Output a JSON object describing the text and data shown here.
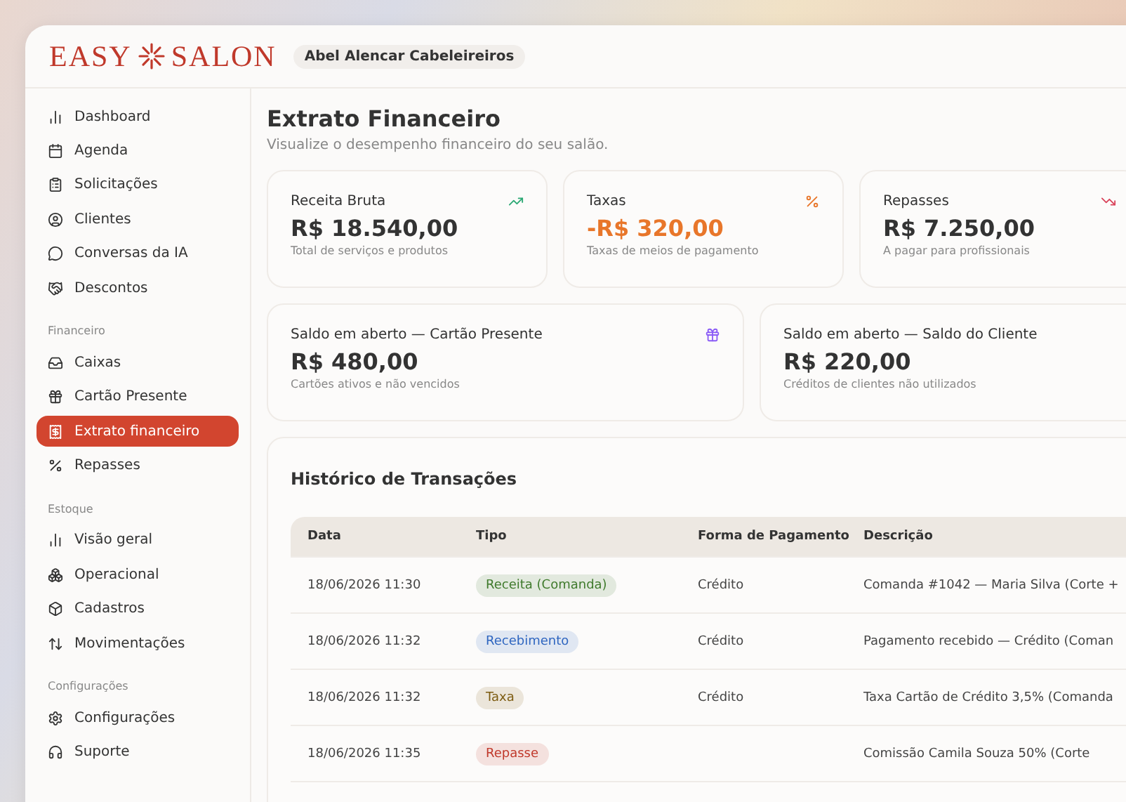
{
  "header": {
    "logo_left": "EASY",
    "logo_right": "SALON",
    "business": "Abel Alencar Cabeleireiros"
  },
  "sidebar": [
    {
      "items": [
        {
          "label": "Dashboard",
          "selected": false
        },
        {
          "label": "Agenda",
          "selected": false
        },
        {
          "label": "Solicitações",
          "selected": false
        },
        {
          "label": "Clientes",
          "selected": false
        },
        {
          "label": "Conversas da IA",
          "selected": false
        },
        {
          "label": "Descontos",
          "selected": false
        }
      ]
    },
    {
      "title": "Financeiro",
      "items": [
        {
          "label": "Caixas",
          "selected": false
        },
        {
          "label": "Cartão Presente",
          "selected": false
        },
        {
          "label": "Extrato financeiro",
          "selected": true
        },
        {
          "label": "Repasses",
          "selected": false
        }
      ]
    },
    {
      "title": "Estoque",
      "items": [
        {
          "label": "Visão geral",
          "selected": false
        },
        {
          "label": "Operacional",
          "selected": false
        },
        {
          "label": "Cadastros",
          "selected": false
        },
        {
          "label": "Movimentações",
          "selected": false
        }
      ]
    },
    {
      "title": "Configurações",
      "items": [
        {
          "label": "Configurações",
          "selected": false
        },
        {
          "label": "Suporte",
          "selected": false
        }
      ]
    }
  ],
  "page": {
    "title": "Extrato Financeiro",
    "subtitle": "Visualize o desempenho financeiro do seu salão."
  },
  "stats": [
    {
      "label": "Receita Bruta",
      "value": "R$ 18.540,00",
      "note": "Total de serviços e produtos",
      "negative": false
    },
    {
      "label": "Taxas",
      "value": "-R$ 320,00",
      "note": "Taxas de meios de pagamento",
      "negative": true
    },
    {
      "label": "Repasses",
      "value": "R$ 7.250,00",
      "note": "A pagar para profissionais",
      "negative": false
    }
  ],
  "balances": [
    {
      "label": "Saldo em aberto — Cartão Presente",
      "value": "R$ 480,00",
      "note": "Cartões ativos e não vencidos"
    },
    {
      "label": "Saldo em aberto — Saldo do Cliente",
      "value": "R$ 220,00",
      "note": "Créditos de clientes não utilizados"
    }
  ],
  "history": {
    "title": "Histórico de Transações",
    "columns": [
      "Data",
      "Tipo",
      "Forma de Pagamento",
      "Descrição"
    ],
    "rows": [
      {
        "date": "18/06/2026 11:30",
        "type": "Receita (Comanda)",
        "color": "#3f7a2c",
        "payment": "Crédito",
        "description": "Comanda #1042 — Maria Silva (Corte +"
      },
      {
        "date": "18/06/2026 11:32",
        "type": "Recebimento",
        "color": "#2f66c0",
        "payment": "Crédito",
        "description": "Pagamento recebido — Crédito (Coman"
      },
      {
        "date": "18/06/2026 11:32",
        "type": "Taxa",
        "color": "#7d5c12",
        "payment": "Crédito",
        "description": "Taxa Cartão de Crédito 3,5% (Comanda"
      },
      {
        "date": "18/06/2026 11:35",
        "type": "Repasse",
        "color": "#c0392b",
        "description": "Comissão Camila Souza 50% (Corte"
      }
    ]
  }
}
